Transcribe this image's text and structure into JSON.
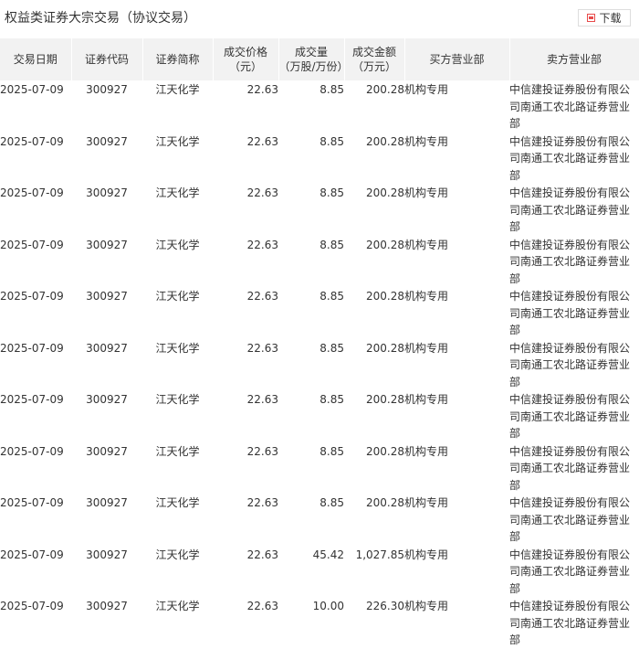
{
  "header": {
    "title": "权益类证券大宗交易（协议交易）",
    "download_label": "下载",
    "download_icon": "download-icon",
    "accent_color": "#e84a4a"
  },
  "table": {
    "columns": [
      {
        "key": "date",
        "label": "交易日期"
      },
      {
        "key": "code",
        "label": "证券代码"
      },
      {
        "key": "name",
        "label": "证券简称"
      },
      {
        "key": "price",
        "label": "成交价格\n（元）"
      },
      {
        "key": "volume",
        "label": "成交量\n（万股/万份）"
      },
      {
        "key": "amount",
        "label": "成交金额\n（万元）"
      },
      {
        "key": "buyer",
        "label": "买方营业部"
      },
      {
        "key": "seller",
        "label": "卖方营业部"
      }
    ],
    "rows": [
      {
        "date": "2025-07-09",
        "code": "300927",
        "name": "江天化学",
        "price": "22.63",
        "volume": "8.85",
        "amount": "200.28",
        "buyer": "机构专用",
        "seller": "中信建投证券股份有限公司南通工农北路证券营业部"
      },
      {
        "date": "2025-07-09",
        "code": "300927",
        "name": "江天化学",
        "price": "22.63",
        "volume": "8.85",
        "amount": "200.28",
        "buyer": "机构专用",
        "seller": "中信建投证券股份有限公司南通工农北路证券营业部"
      },
      {
        "date": "2025-07-09",
        "code": "300927",
        "name": "江天化学",
        "price": "22.63",
        "volume": "8.85",
        "amount": "200.28",
        "buyer": "机构专用",
        "seller": "中信建投证券股份有限公司南通工农北路证券营业部"
      },
      {
        "date": "2025-07-09",
        "code": "300927",
        "name": "江天化学",
        "price": "22.63",
        "volume": "8.85",
        "amount": "200.28",
        "buyer": "机构专用",
        "seller": "中信建投证券股份有限公司南通工农北路证券营业部"
      },
      {
        "date": "2025-07-09",
        "code": "300927",
        "name": "江天化学",
        "price": "22.63",
        "volume": "8.85",
        "amount": "200.28",
        "buyer": "机构专用",
        "seller": "中信建投证券股份有限公司南通工农北路证券营业部"
      },
      {
        "date": "2025-07-09",
        "code": "300927",
        "name": "江天化学",
        "price": "22.63",
        "volume": "8.85",
        "amount": "200.28",
        "buyer": "机构专用",
        "seller": "中信建投证券股份有限公司南通工农北路证券营业部"
      },
      {
        "date": "2025-07-09",
        "code": "300927",
        "name": "江天化学",
        "price": "22.63",
        "volume": "8.85",
        "amount": "200.28",
        "buyer": "机构专用",
        "seller": "中信建投证券股份有限公司南通工农北路证券营业部"
      },
      {
        "date": "2025-07-09",
        "code": "300927",
        "name": "江天化学",
        "price": "22.63",
        "volume": "8.85",
        "amount": "200.28",
        "buyer": "机构专用",
        "seller": "中信建投证券股份有限公司南通工农北路证券营业部"
      },
      {
        "date": "2025-07-09",
        "code": "300927",
        "name": "江天化学",
        "price": "22.63",
        "volume": "8.85",
        "amount": "200.28",
        "buyer": "机构专用",
        "seller": "中信建投证券股份有限公司南通工农北路证券营业部"
      },
      {
        "date": "2025-07-09",
        "code": "300927",
        "name": "江天化学",
        "price": "22.63",
        "volume": "45.42",
        "amount": "1,027.85",
        "buyer": "机构专用",
        "seller": "中信建投证券股份有限公司南通工农北路证券营业部"
      },
      {
        "date": "2025-07-09",
        "code": "300927",
        "name": "江天化学",
        "price": "22.63",
        "volume": "10.00",
        "amount": "226.30",
        "buyer": "机构专用",
        "seller": "中信建投证券股份有限公司南通工农北路证券营业部"
      }
    ]
  }
}
